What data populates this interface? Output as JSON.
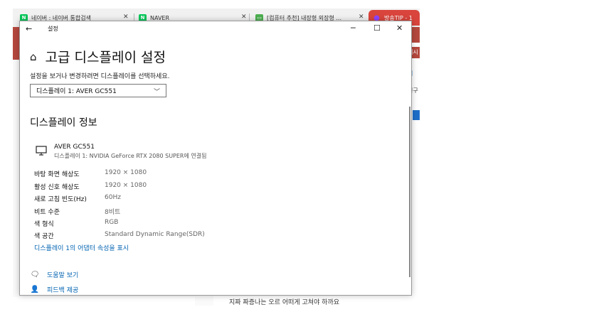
{
  "browser": {
    "tabs": [
      {
        "favicon": "N",
        "favicon_color": "#03c75a",
        "label": "네이버 : 네이버 통합검색",
        "close": "✕"
      },
      {
        "favicon": "N",
        "favicon_color": "#03c75a",
        "label": "NAVER",
        "close": "✕"
      },
      {
        "favicon": "▭",
        "favicon_color": "#4caf50",
        "label": "[컴퓨터 추천] 내장형 외장형 ...",
        "close": "✕"
      },
      {
        "favicon": "●",
        "favicon_color": "#8e44ff",
        "label": "방송TIP - 1",
        "close": ""
      }
    ],
    "side_snippets": [
      "대시",
      "서",
      "친구"
    ],
    "bottom_text": "지짜 짜증나는 오르 어떠게 고쳐야 하까요"
  },
  "window": {
    "title": "설정",
    "back": "←",
    "minimize": "─",
    "maximize": "☐",
    "close": "✕"
  },
  "page": {
    "heading": "고급 디스플레이 설정",
    "prompt": "설정을 보거나 변경하려면 디스플레이를 선택하세요.",
    "display_select": "디스플레이 1: AVER GC551",
    "section_title": "디스플레이 정보",
    "monitor": {
      "name": "AVER GC551",
      "description": "디스플레이 1: NVIDIA GeForce RTX 2080 SUPER에 연결됨"
    },
    "properties": [
      {
        "label": "바탕 화면 해상도",
        "value": "1920 × 1080"
      },
      {
        "label": "활성 신호 해상도",
        "value": "1920 × 1080"
      },
      {
        "label": "새로 고침 빈도(Hz)",
        "value": "60Hz"
      },
      {
        "label": "비트 수준",
        "value": "8비트"
      },
      {
        "label": "색 형식",
        "value": "RGB"
      },
      {
        "label": "색 공간",
        "value": "Standard Dynamic Range(SDR)"
      }
    ],
    "adapter_link": "디스플레이 1의 어댑터 속성을 표시",
    "help": "도움말 보기",
    "feedback": "피드백 제공"
  },
  "colors": {
    "accent_link": "#0063b1",
    "browser_red": "#b5483e"
  }
}
